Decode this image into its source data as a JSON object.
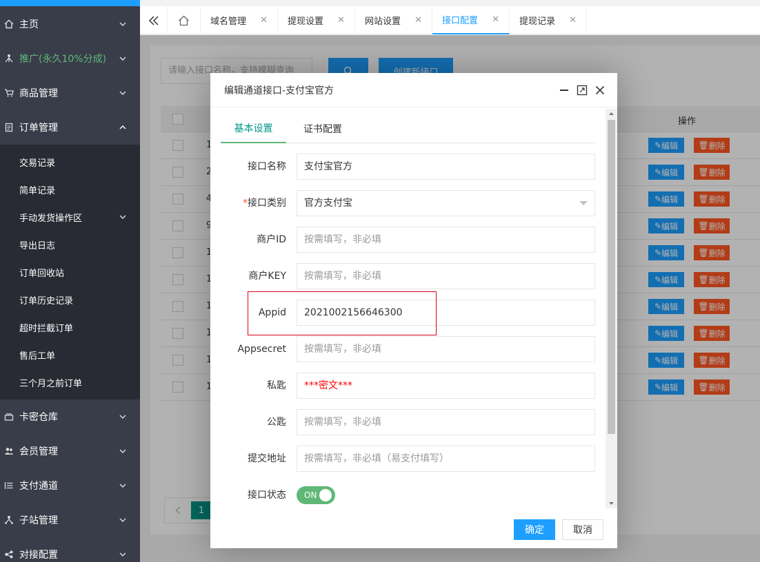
{
  "sidebar": {
    "items": [
      {
        "label": "主页",
        "icon": "home-icon"
      },
      {
        "label": "推广(永久10%分成)",
        "icon": "share-icon"
      },
      {
        "label": "商品管理",
        "icon": "cart-icon"
      },
      {
        "label": "订单管理",
        "icon": "order-icon"
      },
      {
        "label": "卡密仓库",
        "icon": "warehouse-icon"
      },
      {
        "label": "会员管理",
        "icon": "users-icon"
      },
      {
        "label": "支付通道",
        "icon": "list-icon"
      },
      {
        "label": "子站管理",
        "icon": "sitemap-icon"
      },
      {
        "label": "对接配置",
        "icon": "link-icon"
      }
    ],
    "order_submenu": [
      "交易记录",
      "简单记录",
      "手动发货操作区",
      "导出日志",
      "订单回收站",
      "订单历史记录",
      "超时拦截订单",
      "售后工单",
      "三个月之前订单"
    ]
  },
  "tabs": [
    {
      "label": "域名管理"
    },
    {
      "label": "提现设置"
    },
    {
      "label": "网站设置"
    },
    {
      "label": "接口配置"
    },
    {
      "label": "提现记录"
    }
  ],
  "list": {
    "search_placeholder": "请输入接口名称，支持模糊查询",
    "create_label": "创建新接口",
    "ops_header": "操作",
    "edit_label": "编辑",
    "delete_label": "删除",
    "row_ids": [
      "1",
      "2",
      "4",
      "9",
      "1",
      "1",
      "1",
      "1",
      "1",
      "1"
    ],
    "page_current": "1"
  },
  "modal": {
    "title": "编辑通道接口-支付宝官方",
    "tab_basic": "基本设置",
    "tab_cert": "证书配置",
    "fields": {
      "name_label": "接口名称",
      "name_value": "支付宝官方",
      "type_required": "*",
      "type_label": "接口类别",
      "type_value": "官方支付宝",
      "mchid_label": "商户ID",
      "mchid_placeholder": "按需填写，非必填",
      "mchkey_label": "商户KEY",
      "mchkey_placeholder": "按需填写，非必填",
      "appid_label": "Appid",
      "appid_value": "2021002156646300",
      "appsecret_label": "Appsecret",
      "appsecret_placeholder": "按需填写，非必填",
      "privkey_label": "私匙",
      "privkey_value": "***密文***",
      "pubkey_label": "公匙",
      "pubkey_placeholder": "按需填写，非必填",
      "submit_label": "提交地址",
      "submit_placeholder": "按需填写，非必填（易支付填写）",
      "status_label": "接口状态",
      "status_value": "ON"
    },
    "ok_label": "确定",
    "cancel_label": "取消"
  },
  "colors": {
    "accent": "#1E9FFF",
    "sidebar": "#393D49",
    "submenu": "#282B33",
    "green": "#5FB878",
    "danger": "#FF5722",
    "highlight": "#d9001b"
  }
}
